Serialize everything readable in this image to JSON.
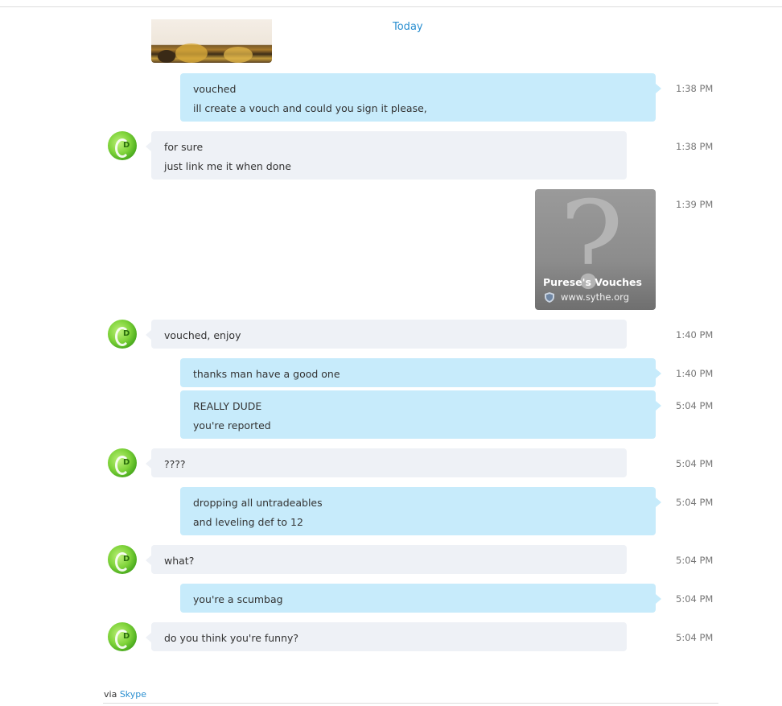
{
  "date_separator": "Today",
  "messages": [
    {
      "lines": [
        "vouched",
        "ill create a vouch and could you sign it please,"
      ],
      "time": "1:38 PM"
    },
    {
      "lines": [
        "for sure",
        "just link me it when done"
      ],
      "time": "1:38 PM"
    },
    {
      "card": {
        "title": "Purese's Vouches",
        "url": "www.sythe.org",
        "icon": "shield-icon"
      },
      "time": "1:39 PM"
    },
    {
      "lines": [
        "vouched, enjoy"
      ],
      "time": "1:40 PM"
    },
    {
      "lines": [
        "thanks man have a good one"
      ],
      "time": "1:40 PM"
    },
    {
      "lines": [
        "REALLY DUDE",
        "you're reported"
      ],
      "time": "5:04 PM"
    },
    {
      "lines": [
        "????"
      ],
      "time": "5:04 PM"
    },
    {
      "lines": [
        "dropping all untradeables",
        "and leveling def to 12"
      ],
      "time": "5:04 PM"
    },
    {
      "lines": [
        "what?"
      ],
      "time": "5:04 PM"
    },
    {
      "lines": [
        "you're a scumbag"
      ],
      "time": "5:04 PM"
    },
    {
      "lines": [
        "do you think you're funny?"
      ],
      "time": "5:04 PM"
    }
  ],
  "footer": {
    "via": "via",
    "service": "Skype"
  },
  "colors": {
    "outgoing_bubble": "#c7ebfb",
    "incoming_bubble": "#eef1f6",
    "link_accent": "#2b8fd0"
  }
}
